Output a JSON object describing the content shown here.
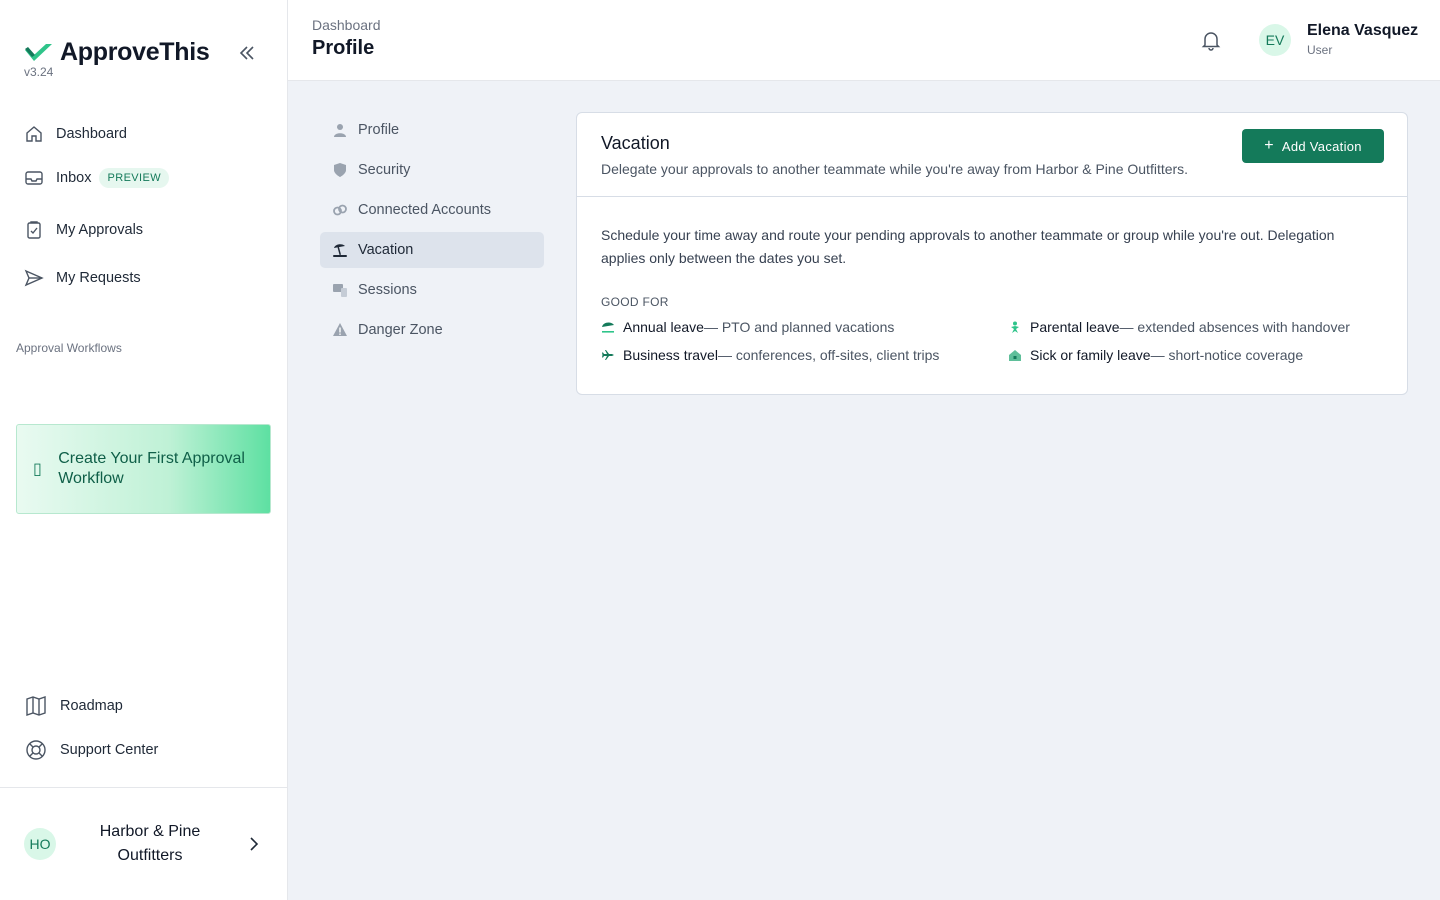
{
  "app": {
    "name": "ApproveThis",
    "version": "v3.24",
    "accent": "#147a5a"
  },
  "sidebar": {
    "nav": [
      {
        "label": "Dashboard",
        "icon": "home-icon"
      },
      {
        "label": "Inbox",
        "icon": "inbox-icon",
        "badge": "PREVIEW"
      },
      {
        "label": "My Approvals",
        "icon": "clipboard-check-icon"
      },
      {
        "label": "My Requests",
        "icon": "send-icon"
      }
    ],
    "section_label": "Approval Workflows",
    "cta": {
      "label": "Create Your First Approval Workflow",
      "icon": "plus-box-icon"
    },
    "bottom": [
      {
        "label": "Roadmap",
        "icon": "map-icon"
      },
      {
        "label": "Support Center",
        "icon": "lifebuoy-icon"
      }
    ],
    "org": {
      "initials": "HO",
      "name": "Harbor & Pine Outfitters"
    }
  },
  "header": {
    "breadcrumb": "Dashboard",
    "title": "Profile",
    "user": {
      "initials": "EV",
      "name": "Elena Vasquez",
      "role": "User"
    }
  },
  "settings_nav": [
    {
      "label": "Profile",
      "icon": "user-icon",
      "active": false
    },
    {
      "label": "Security",
      "icon": "shield-icon",
      "active": false
    },
    {
      "label": "Connected Accounts",
      "icon": "link-icon",
      "active": false
    },
    {
      "label": "Vacation",
      "icon": "beach-icon",
      "active": true
    },
    {
      "label": "Sessions",
      "icon": "devices-icon",
      "active": false
    },
    {
      "label": "Danger Zone",
      "icon": "warning-icon",
      "active": false
    }
  ],
  "vacation": {
    "title": "Vacation",
    "subtitle": "Delegate your approvals to another teammate while you're away from Harbor & Pine Outfitters.",
    "add_button": "Add Vacation",
    "description": "Schedule your time away and route your pending approvals to another teammate or group while you're out. Delegation applies only between the dates you set.",
    "good_for_label": "GOOD FOR",
    "good_for": [
      {
        "title": "Annual leave",
        "detail": " — PTO and planned vacations",
        "icon": "umbrella-icon"
      },
      {
        "title": "Parental leave",
        "detail": " — extended absences with handover",
        "icon": "baby-icon"
      },
      {
        "title": "Business travel",
        "detail": " — conferences, off-sites, client trips",
        "icon": "plane-icon"
      },
      {
        "title": "Sick or family leave",
        "detail": " — short-notice coverage",
        "icon": "house-icon"
      }
    ]
  }
}
